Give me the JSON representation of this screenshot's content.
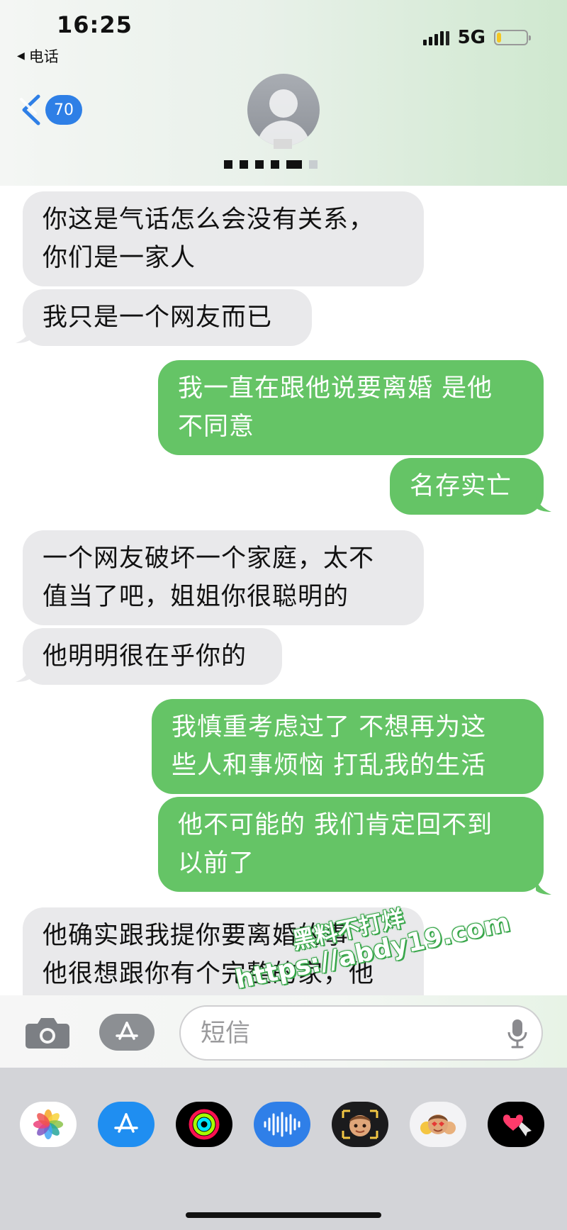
{
  "status_bar": {
    "time": "16:25",
    "back_app": "电话",
    "network": "5G",
    "battery_level": 0.15
  },
  "header": {
    "unread_count": "70"
  },
  "messages": [
    {
      "dir": "in",
      "lines": [
        "你这是气话怎么会没有关系，",
        "你们是一家人"
      ]
    },
    {
      "dir": "in",
      "lines": [
        "我只是一个网友而已"
      ]
    },
    {
      "dir": "out",
      "lines": [
        "我一直在跟他说要离婚  是他",
        "不同意"
      ]
    },
    {
      "dir": "out",
      "lines": [
        "名存实亡"
      ]
    },
    {
      "dir": "in",
      "lines": [
        "一个网友破坏一个家庭，太不",
        "值当了吧，姐姐你很聪明的"
      ]
    },
    {
      "dir": "in",
      "lines": [
        "他明明很在乎你的"
      ]
    },
    {
      "dir": "out",
      "lines": [
        "我慎重考虑过了  不想再为这",
        "些人和事烦恼  打乱我的生活"
      ]
    },
    {
      "dir": "out",
      "lines": [
        "他不可能的  我们肯定回不到",
        "以前了"
      ]
    },
    {
      "dir": "in",
      "lines": [
        "他确实跟我提你要离婚的事",
        "他很想跟你有个完整的家，他"
      ]
    }
  ],
  "watermark": {
    "line1": "黑料不打烊",
    "line2": "https://abdy19.com"
  },
  "composer": {
    "placeholder": "短信"
  },
  "app_drawer": [
    "photos-app",
    "app-store-app",
    "fitness-app",
    "audio-message-app",
    "memoji-app",
    "memoji-stickers-app",
    "digital-touch-app"
  ],
  "colors": {
    "outgoing_bubble": "#65c466",
    "incoming_bubble": "#e9e9eb",
    "badge": "#2e7fe6"
  }
}
